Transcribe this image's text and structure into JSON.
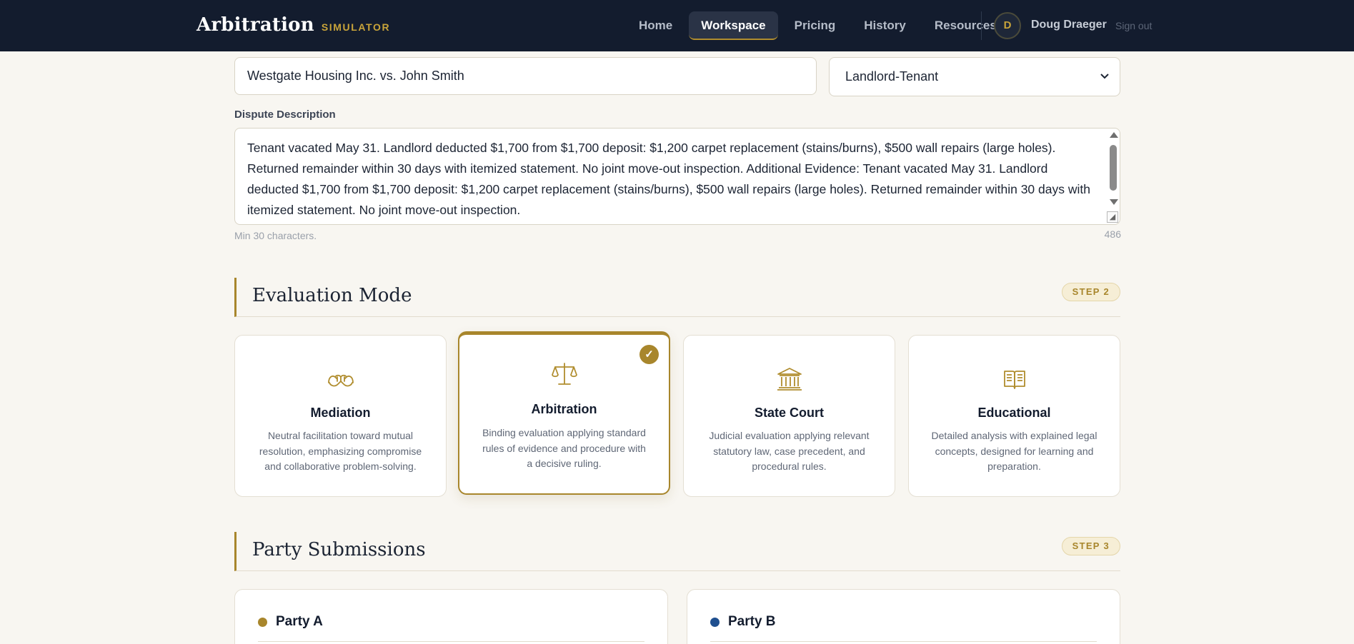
{
  "header": {
    "brand": "Arbitration",
    "brand_sub": "SIMULATOR",
    "nav": [
      {
        "label": "Home",
        "active": false
      },
      {
        "label": "Workspace",
        "active": true
      },
      {
        "label": "Pricing",
        "active": false
      },
      {
        "label": "History",
        "active": false
      },
      {
        "label": "Resources",
        "active": false
      }
    ],
    "user_initial": "D",
    "user_name": "Doug Draeger",
    "signout": "Sign out"
  },
  "case": {
    "title_value": "Westgate Housing Inc. vs. John Smith",
    "type_value": "Landlord-Tenant",
    "description_label": "Dispute Description",
    "description_value": "Tenant vacated May 31. Landlord deducted $1,700 from $1,700 deposit: $1,200 carpet replacement (stains/burns), $500 wall repairs (large holes). Returned remainder within 30 days with itemized statement. No joint move-out inspection. Additional Evidence: Tenant vacated May 31. Landlord deducted $1,700 from $1,700 deposit: $1,200 carpet replacement (stains/burns), $500 wall repairs (large holes). Returned remainder within 30 days with itemized statement. No joint move-out inspection.",
    "description_hint": "Min 30 characters.",
    "char_count": "486"
  },
  "evaluation": {
    "title": "Evaluation Mode",
    "step": "STEP 2",
    "modes": [
      {
        "icon": "handshake-icon",
        "title": "Mediation",
        "desc": "Neutral facilitation toward mutual resolution, emphasizing compromise and collaborative problem-solving.",
        "selected": false
      },
      {
        "icon": "scales-icon",
        "title": "Arbitration",
        "desc": "Binding evaluation applying standard rules of evidence and procedure with a decisive ruling.",
        "selected": true
      },
      {
        "icon": "courthouse-icon",
        "title": "State Court",
        "desc": "Judicial evaluation applying relevant statutory law, case precedent, and procedural rules.",
        "selected": false
      },
      {
        "icon": "book-icon",
        "title": "Educational",
        "desc": "Detailed analysis with explained legal concepts, designed for learning and preparation.",
        "selected": false
      }
    ],
    "check_glyph": "✓"
  },
  "parties": {
    "title": "Party Submissions",
    "step": "STEP 3",
    "items": [
      {
        "name": "Party A",
        "color": "#a8862c"
      },
      {
        "name": "Party B",
        "color": "#1f4f8f"
      }
    ]
  },
  "colors": {
    "navy": "#131c2e",
    "gold": "#a8862c",
    "background": "#f8f6f1"
  }
}
